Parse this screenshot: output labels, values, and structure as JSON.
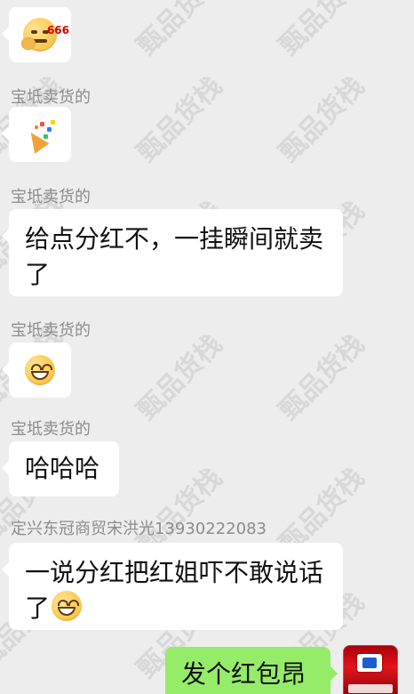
{
  "watermark": {
    "text": "甄品货栈"
  },
  "messages": [
    {
      "id": "m1",
      "sender": "",
      "type": "sticker",
      "sticker": "smirk-666-emoji-icon",
      "badge": "666"
    },
    {
      "id": "m2",
      "sender": "宝坻卖货的",
      "type": "emoji",
      "emoji": "party-popper-icon"
    },
    {
      "id": "m3",
      "sender": "宝坻卖货的",
      "type": "text",
      "text": "给点分红不，一挂瞬间就卖了"
    },
    {
      "id": "m4",
      "sender": "宝坻卖货的",
      "type": "emoji",
      "emoji": "grin-emoji-icon"
    },
    {
      "id": "m5",
      "sender": "宝坻卖货的",
      "type": "text",
      "text": "哈哈哈"
    },
    {
      "id": "m6",
      "sender": "定兴东冠商贸宋洪光13930222083",
      "type": "text",
      "text": "一说分红把红姐吓不敢说话了"
    },
    {
      "id": "m7",
      "sender": "",
      "type": "text",
      "text": "发个红包昂"
    }
  ],
  "colors": {
    "background": "#ededed",
    "bubble_left": "#ffffff",
    "bubble_right": "#95ec69",
    "sender": "#8c8c8c",
    "text": "#111111"
  }
}
